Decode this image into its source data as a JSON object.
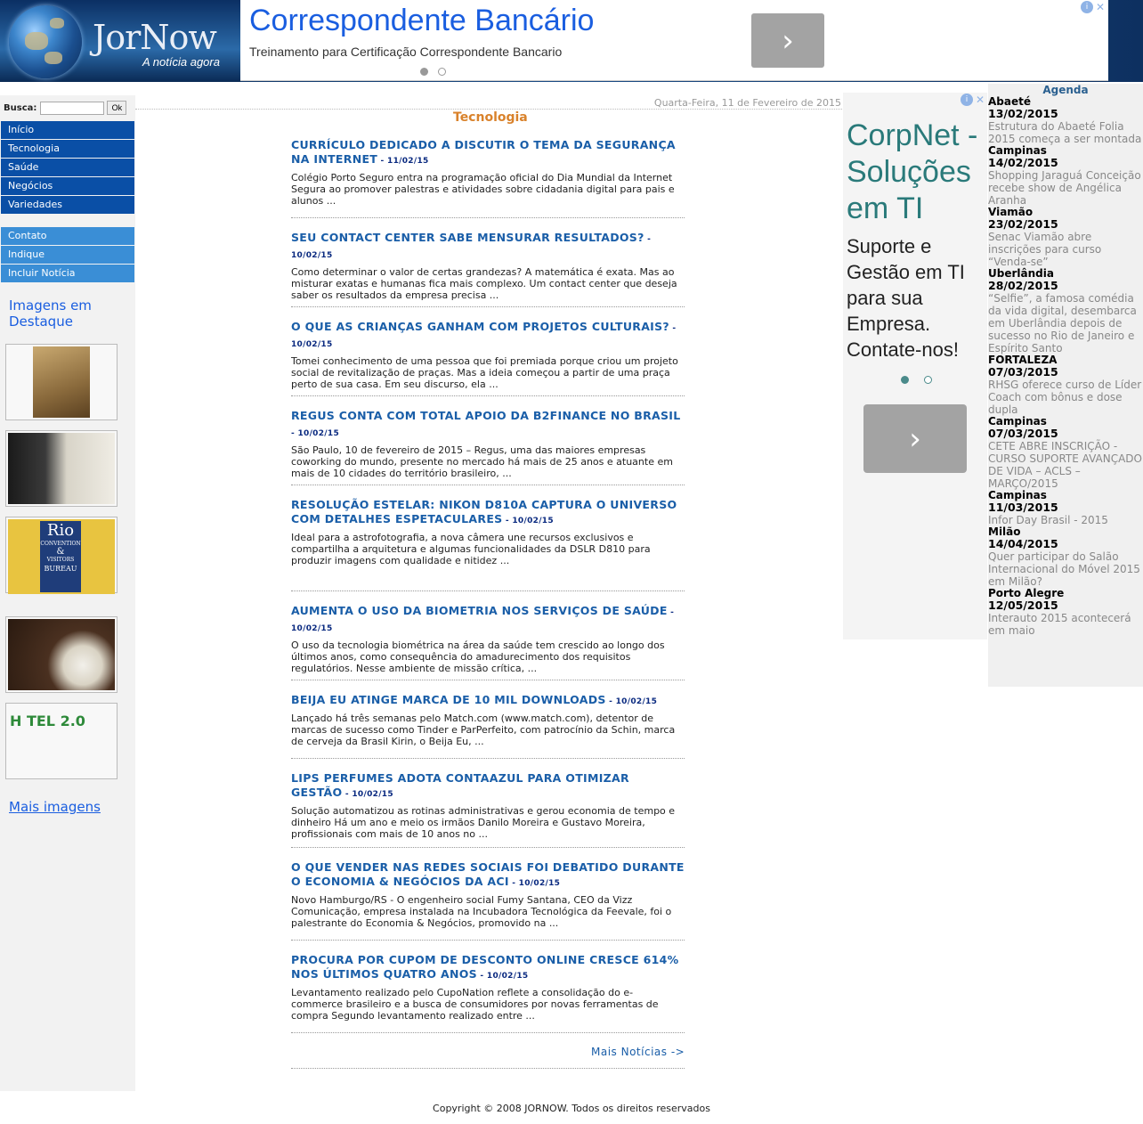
{
  "header": {
    "logo_text": "JorNow",
    "logo_tagline": "A notícia agora",
    "ad": {
      "title": "Correspondente Bancário",
      "subtitle": "Treinamento para Certificação Correspondente Bancario",
      "arrow": "›",
      "info": "i",
      "close": "✕"
    }
  },
  "sidebar": {
    "search_label": "Busca:",
    "search_value": "",
    "search_button": "Ok",
    "nav_primary": [
      "Início",
      "Tecnologia",
      "Saúde",
      "Negócios",
      "Variedades"
    ],
    "nav_secondary": [
      "Contato",
      "Indique",
      "Incluir Notícia"
    ],
    "images_heading": "Imagens em Destaque",
    "more_images": "Mais imagens",
    "thumb_texts": {
      "rio_line1": "Rio",
      "rio_line2": "CONVENTION",
      "rio_line3": "&",
      "rio_line4": "VISITORS",
      "rio_line5": "BUREAU",
      "hotel": "H TEL 2.0"
    }
  },
  "main": {
    "date": "Quarta-Feira, 11 de Fevereiro de 2015",
    "section_title": "Tecnologia",
    "articles": [
      {
        "title": "CURRÍCULO DEDICADO A DISCUTIR O TEMA DA SEGURANÇA NA INTERNET",
        "date": "11/02/15",
        "body": "Colégio Porto Seguro entra na programação oficial do Dia Mundial da Internet Segura ao promover palestras e atividades sobre cidadania digital para pais e alunos ..."
      },
      {
        "title": "SEU CONTACT CENTER SABE MENSURAR RESULTADOS?",
        "date": "10/02/15",
        "body": "Como determinar o valor de certas grandezas? A matemática é exata. Mas ao misturar exatas e humanas fica mais complexo. Um contact center que deseja saber os resultados da empresa precisa ..."
      },
      {
        "title": "O QUE AS CRIANÇAS GANHAM COM PROJETOS CULTURAIS?",
        "date": "10/02/15",
        "body": "Tomei conhecimento de uma pessoa que foi premiada porque criou um projeto social de revitalização de praças. Mas a ideia começou a partir de uma praça perto de sua casa. Em seu discurso, ela ..."
      },
      {
        "title": "REGUS CONTA COM TOTAL APOIO DA B2FINANCE NO BRASIL",
        "date": "10/02/15",
        "body": "São Paulo, 10 de fevereiro de 2015 – Regus, uma das maiores empresas coworking do mundo, presente no mercado há mais de 25 anos e atuante em mais de 10 cidades do território brasileiro, ..."
      },
      {
        "title": "RESOLUÇÃO ESTELAR: NIKON D810A CAPTURA O UNIVERSO COM DETALHES ESPETACULARES",
        "date": "10/02/15",
        "body": "Ideal para a astrofotografia, a nova câmera une recursos exclusivos e compartilha a arquitetura e algumas funcionalidades da DSLR D810 para produzir imagens com qualidade e nitidez ..."
      },
      {
        "title": "AUMENTA O USO DA BIOMETRIA NOS SERVIÇOS DE SAÚDE",
        "date": "10/02/15",
        "body": "O uso da tecnologia biométrica na área da saúde tem crescido ao longo dos últimos anos, como consequência do amadurecimento dos requisitos regulatórios. Nesse ambiente de missão crítica, ..."
      },
      {
        "title": "BEIJA EU ATINGE MARCA DE 10 MIL DOWNLOADS",
        "date": "10/02/15",
        "body": "Lançado há três semanas pelo Match.com (www.match.com), detentor de marcas de sucesso como Tinder e ParPerfeito, com patrocínio da Schin, marca de cerveja da Brasil Kirin, o Beija Eu, ..."
      },
      {
        "title": "LIPS PERFUMES ADOTA CONTAAZUL PARA OTIMIZAR GESTÃO",
        "date": "10/02/15",
        "body": "Solução automatizou as rotinas administrativas e gerou economia de tempo e dinheiro Há um ano e meio os irmãos Danilo Moreira e Gustavo Moreira, profissionais com mais de 10 anos no ..."
      },
      {
        "title": "O QUE VENDER NAS REDES SOCIAIS FOI DEBATIDO DURANTE O ECONOMIA & NEGÓCIOS DA ACI",
        "date": "10/02/15",
        "body": "Novo Hamburgo/RS - O engenheiro social Fumy Santana, CEO da Vizz Comunicação, empresa instalada na Incubadora Tecnológica da Feevale, foi o palestrante do Economia & Negócios, promovido na ..."
      },
      {
        "title": "PROCURA POR CUPOM DE DESCONTO ONLINE CRESCE 614% NOS ÚLTIMOS QUATRO ANOS",
        "date": "10/02/15",
        "body": "Levantamento realizado pelo CupoNation reflete a consolidação do e-commerce brasileiro e a busca de consumidores por novas ferramentas de compra Segundo levantamento realizado entre ..."
      }
    ],
    "date_separator": " - ",
    "more_news": "Mais Notícias ->",
    "copyright": "Copyright © 2008 JORNOW. Todos os direitos reservados"
  },
  "side_ad": {
    "title": "CorpNet - Soluções em TI",
    "text": "Suporte e Gestão em TI para sua Empresa. Contate-nos!",
    "arrow": "›",
    "info": "i",
    "close": "✕"
  },
  "agenda": {
    "title": "Agenda",
    "events": [
      {
        "city": "Abaeté",
        "date": "13/02/2015",
        "text": "Estrutura do Abaeté Folia 2015 começa a ser montada"
      },
      {
        "city": "Campinas",
        "date": "14/02/2015",
        "text": "Shopping Jaraguá Conceição recebe show de Angélica Aranha"
      },
      {
        "city": "Viamão",
        "date": "23/02/2015",
        "text": "Senac Viamão abre inscrições para curso “Venda-se”"
      },
      {
        "city": "Uberlândia",
        "date": "28/02/2015",
        "text": "“Selfie”, a famosa comédia da vida digital, desembarca em Uberlândia depois de sucesso no Rio de Janeiro e Espírito Santo"
      },
      {
        "city": "FORTALEZA",
        "date": "07/03/2015",
        "text": "RHSG oferece curso de Líder Coach com bônus e dose dupla"
      },
      {
        "city": "Campinas",
        "date": "07/03/2015",
        "text": "CETE ABRE INSCRIÇÃO - CURSO SUPORTE AVANÇADO DE VIDA – ACLS – MARÇO/2015"
      },
      {
        "city": "Campinas",
        "date": "11/03/2015",
        "text": "Infor Day Brasil - 2015"
      },
      {
        "city": "Milão",
        "date": "14/04/2015",
        "text": "Quer participar do Salão Internacional do Móvel 2015 em Milão?"
      },
      {
        "city": "Porto Alegre",
        "date": "12/05/2015",
        "text": "Interauto 2015 acontecerá em maio"
      }
    ]
  }
}
